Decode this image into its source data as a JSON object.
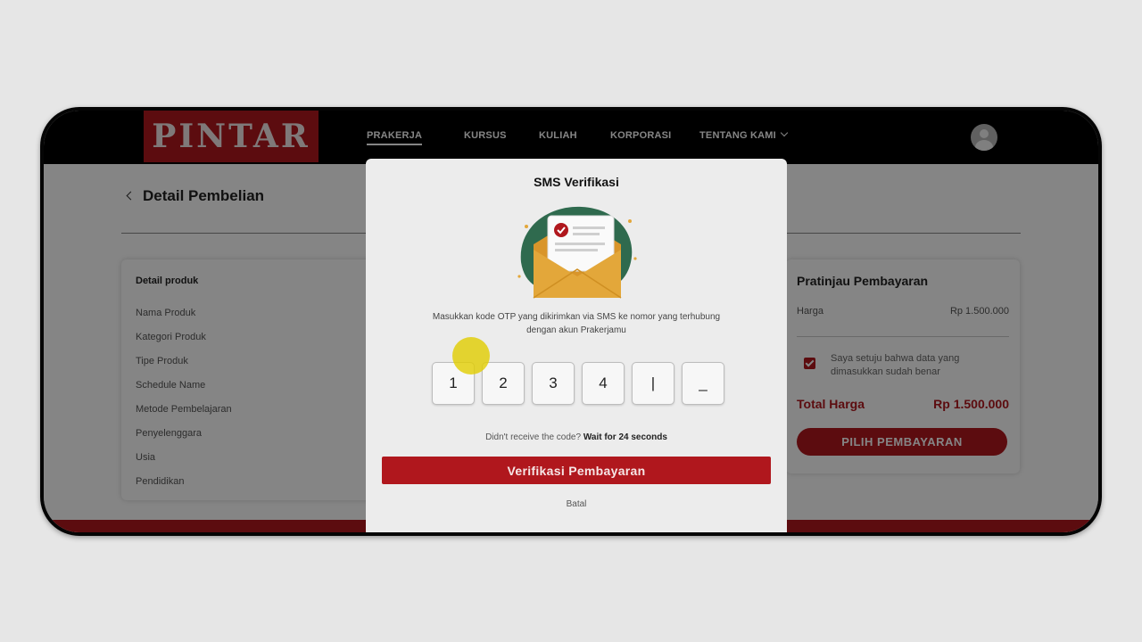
{
  "navbar": {
    "logo": "PINTAR",
    "items": [
      {
        "label": "PRAKERJA",
        "active": true
      },
      {
        "label": "KURSUS"
      },
      {
        "label": "KULIAH"
      },
      {
        "label": "KORPORASI"
      },
      {
        "label": "TENTANG KAMI"
      }
    ]
  },
  "page": {
    "title": "Detail Pembelian",
    "product_card": {
      "heading": "Detail produk",
      "labels": [
        "Nama Produk",
        "Kategori Produk",
        "Tipe Produk",
        "Schedule Name",
        "Metode Pembelajaran",
        "Penyelenggara",
        "Usia",
        "Pendidikan"
      ]
    },
    "preview": {
      "title": "Pratinjau Pembayaran",
      "price_label": "Harga",
      "price_value": "Rp 1.500.000",
      "agree_text": "Saya setuju bahwa data yang dimasukkan sudah benar",
      "total_label": "Total Harga",
      "total_value": "Rp 1.500.000",
      "pay_button": "PILIH PEMBAYARAN"
    }
  },
  "modal": {
    "title": "SMS Verifikasi",
    "instruction": "Masukkan kode OTP yang dikirimkan via SMS ke nomor yang terhubung dengan akun Prakerjamu",
    "otp_digits": [
      "1",
      "2",
      "3",
      "4",
      "|",
      "_"
    ],
    "resend_prefix": "Didn't receive the code?",
    "resend_wait": "Wait for 24 seconds",
    "verify_button": "Verifikasi Pembayaran",
    "cancel": "Batal"
  },
  "colors": {
    "brand": "#b0171d",
    "envelope": "#e3a73a",
    "illustration_bg": "#2f6a4e"
  }
}
